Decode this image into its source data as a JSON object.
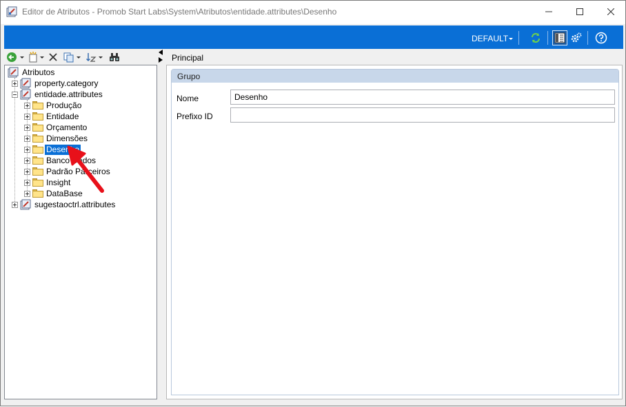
{
  "window": {
    "title": "Editor de Atributos - Promob Start Labs\\System\\Atributos\\entidade.attributes\\Desenho"
  },
  "command_bar": {
    "profile_label": "DEFAULT",
    "buttons": [
      "refresh-icon",
      "properties-view-icon",
      "settings-icon",
      "help-icon"
    ]
  },
  "left_toolbar": {
    "buttons": [
      "back-icon",
      "new-item-icon",
      "delete-icon",
      "copy-icon",
      "sort-icon",
      "find-icon"
    ]
  },
  "tree": {
    "root": "Atributos",
    "items": [
      {
        "label": "property.category"
      },
      {
        "label": "entidade.attributes"
      },
      {
        "label": "Produção"
      },
      {
        "label": "Entidade"
      },
      {
        "label": "Orçamento"
      },
      {
        "label": "Dimensões"
      },
      {
        "label": "Desenho",
        "selected": true
      },
      {
        "label": "Banco Dados"
      },
      {
        "label": "Padrão Parceiros"
      },
      {
        "label": "Insight"
      },
      {
        "label": "DataBase"
      },
      {
        "label": "sugestaoctrl.attributes"
      }
    ]
  },
  "right": {
    "tab_label": "Principal",
    "group_label": "Grupo",
    "fields": [
      {
        "label": "Nome",
        "value": "Desenho"
      },
      {
        "label": "Prefixo ID",
        "value": ""
      }
    ]
  },
  "colors": {
    "accent": "#0a6fd6",
    "annotation_arrow": "#e8101a"
  }
}
